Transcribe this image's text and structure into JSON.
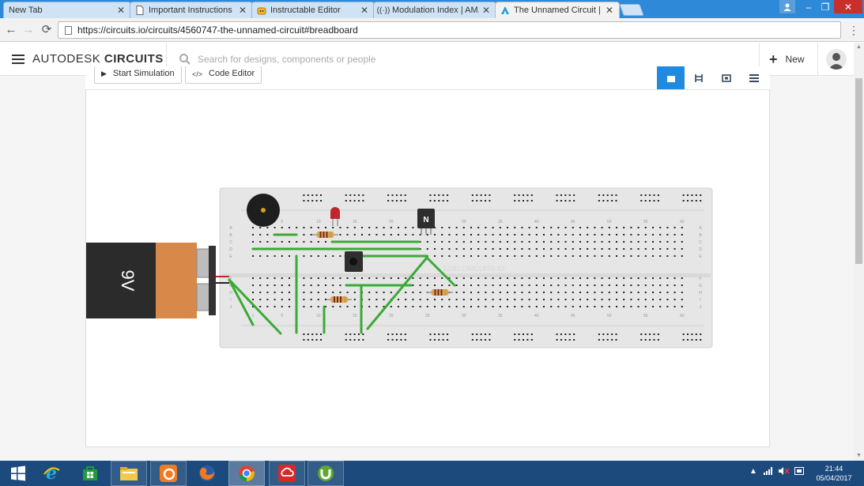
{
  "browser": {
    "tabs": [
      {
        "title": "New Tab",
        "favicon": "none"
      },
      {
        "title": "Important Instructions",
        "favicon": "document-icon"
      },
      {
        "title": "Instructable Editor",
        "favicon": "instructables-robot-icon"
      },
      {
        "title": "Modulation Index | AM, A",
        "favicon": "broadcast-icon"
      },
      {
        "title": "The Unnamed Circuit | A",
        "favicon": "autodesk-icon"
      }
    ],
    "url": "https://circuits.io/circuits/4560747-the-unnamed-circuit#breadboard"
  },
  "app": {
    "brand_light": "AUTODESK",
    "brand_bold": "CIRCUITS",
    "search_placeholder": "Search for designs, components or people",
    "new_label": "New"
  },
  "editor": {
    "start_simulation": "Start Simulation",
    "code_editor": "Code Editor",
    "view_tabs": [
      "breadboard-view",
      "schematic-view",
      "pcb-view",
      "component-list"
    ],
    "active_view": 0
  },
  "breadboard": {
    "battery_label": "9V",
    "transistor_label": "N",
    "watermark": "123D.CIRCUITS.IO",
    "column_numbers": [
      "1",
      "5",
      "10",
      "15",
      "20",
      "25",
      "30",
      "35",
      "40",
      "45",
      "50",
      "55",
      "60"
    ],
    "row_letters_top": [
      "A",
      "B",
      "C",
      "D",
      "E"
    ],
    "row_letters_bottom": [
      "F",
      "G",
      "H",
      "I",
      "J"
    ],
    "colors": {
      "wire": "#3aaa35",
      "board": "#e6e6e6",
      "battery_body": "#2b2b2b",
      "battery_cap": "#d8894a",
      "accent": "#1f8ae0"
    }
  },
  "taskbar": {
    "apps": [
      "start-icon",
      "internet-explorer-icon",
      "store-icon",
      "file-explorer-icon",
      "uc-browser-icon",
      "firefox-icon",
      "chrome-icon",
      "creative-cloud-icon",
      "utorrent-icon"
    ],
    "time": "21:44",
    "date": "05/04/2017"
  }
}
